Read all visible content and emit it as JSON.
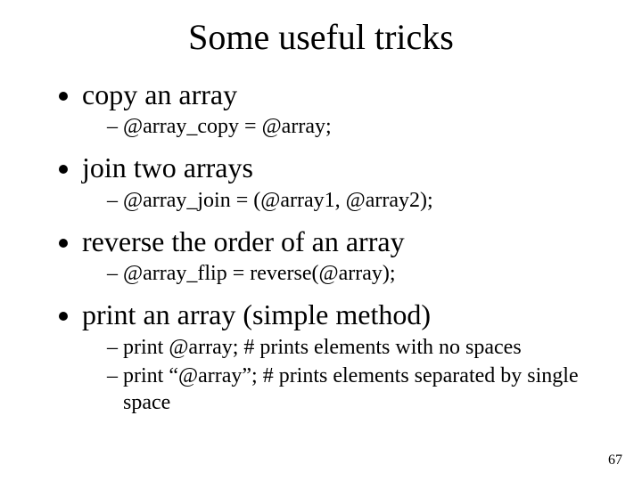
{
  "title": "Some useful tricks",
  "s1": {
    "h": "copy an array",
    "a": "@array_copy = @array;"
  },
  "s2": {
    "h": "join two arrays",
    "a": "@array_join = (@array1, @array2);"
  },
  "s3": {
    "h": "reverse the order of an array",
    "a": "@array_flip = reverse(@array);"
  },
  "s4": {
    "h": "print an array (simple method)",
    "a": "print @array;  # prints elements with no spaces",
    "b": "print “@array”; # prints elements separated by single space"
  },
  "page": "67"
}
